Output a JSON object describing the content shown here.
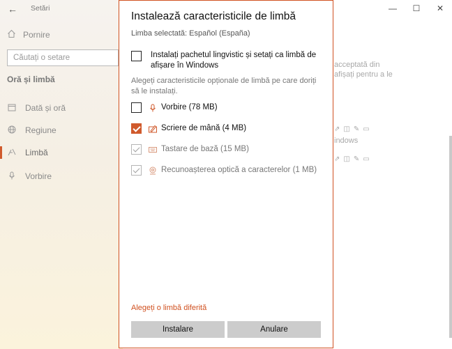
{
  "app": {
    "title": "Setări",
    "search_placeholder": "Căutați o setare",
    "home_label": "Pornire",
    "section_title": "Oră și limbă",
    "nav_items": [
      {
        "label": "Dată și oră",
        "icon": "calendar-icon"
      },
      {
        "label": "Regiune",
        "icon": "globe-icon"
      },
      {
        "label": "Limbă",
        "icon": "language-icon"
      },
      {
        "label": "Vorbire",
        "icon": "microphone-icon"
      }
    ],
    "active_nav": "Limbă",
    "background_text": {
      "line1": "acceptată din",
      "line2": "afișați pentru a le",
      "line3": "indows"
    },
    "window_controls": {
      "minimize": "—",
      "maximize": "☐",
      "close": "✕"
    },
    "accent_color": "#d05a2c"
  },
  "dialog": {
    "title": "Instalează caracteristicile de limbă",
    "selected_language": "Limba selectată: Español (España)",
    "language_pack": {
      "label": "Instalați pachetul lingvistic și setați ca limbă de afișare în Windows",
      "checked": false
    },
    "optional_description": "Alegeți caracteristicile opționale de limbă pe care doriți să le instalați.",
    "features": [
      {
        "label": "Vorbire (78 MB)",
        "icon": "microphone-icon",
        "checked": false,
        "disabled": false
      },
      {
        "label": "Scriere de mână (4 MB)",
        "icon": "handwriting-icon",
        "checked": true,
        "disabled": false
      },
      {
        "label": "Tastare de bază (15 MB)",
        "icon": "keyboard-icon",
        "checked": true,
        "disabled": true
      },
      {
        "label": "Recunoașterea optică a caracterelor (1 MB)",
        "icon": "ocr-icon",
        "checked": true,
        "disabled": true
      }
    ],
    "choose_other_link": "Alegeți o limbă diferită",
    "install_button": "Instalare",
    "cancel_button": "Anulare"
  }
}
